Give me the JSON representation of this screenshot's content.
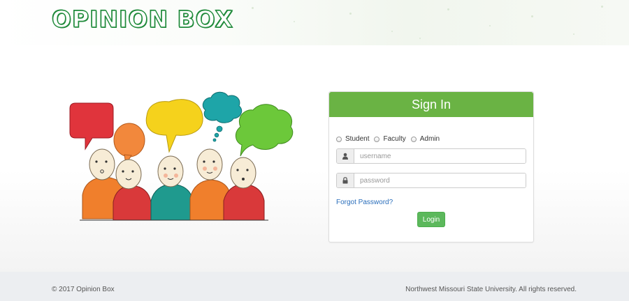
{
  "header": {
    "logo_text_1": "Opinion",
    "logo_text_2": "Box"
  },
  "signin": {
    "title": "Sign In",
    "roles": [
      {
        "label": "Student"
      },
      {
        "label": "Faculty"
      },
      {
        "label": "Admin"
      }
    ],
    "username_placeholder": "username",
    "password_placeholder": "password",
    "forgot_label": "Forgot Password?",
    "login_label": "Login",
    "accent_color": "#6ab344",
    "button_color": "#5cb85c",
    "link_color": "#2a6ebb"
  },
  "illustration": {
    "icon": "people-talking-illustration"
  },
  "footer": {
    "copyright": "© 2017 Opinion Box",
    "rights": "Northwest Missouri State University. All rights reserved."
  }
}
